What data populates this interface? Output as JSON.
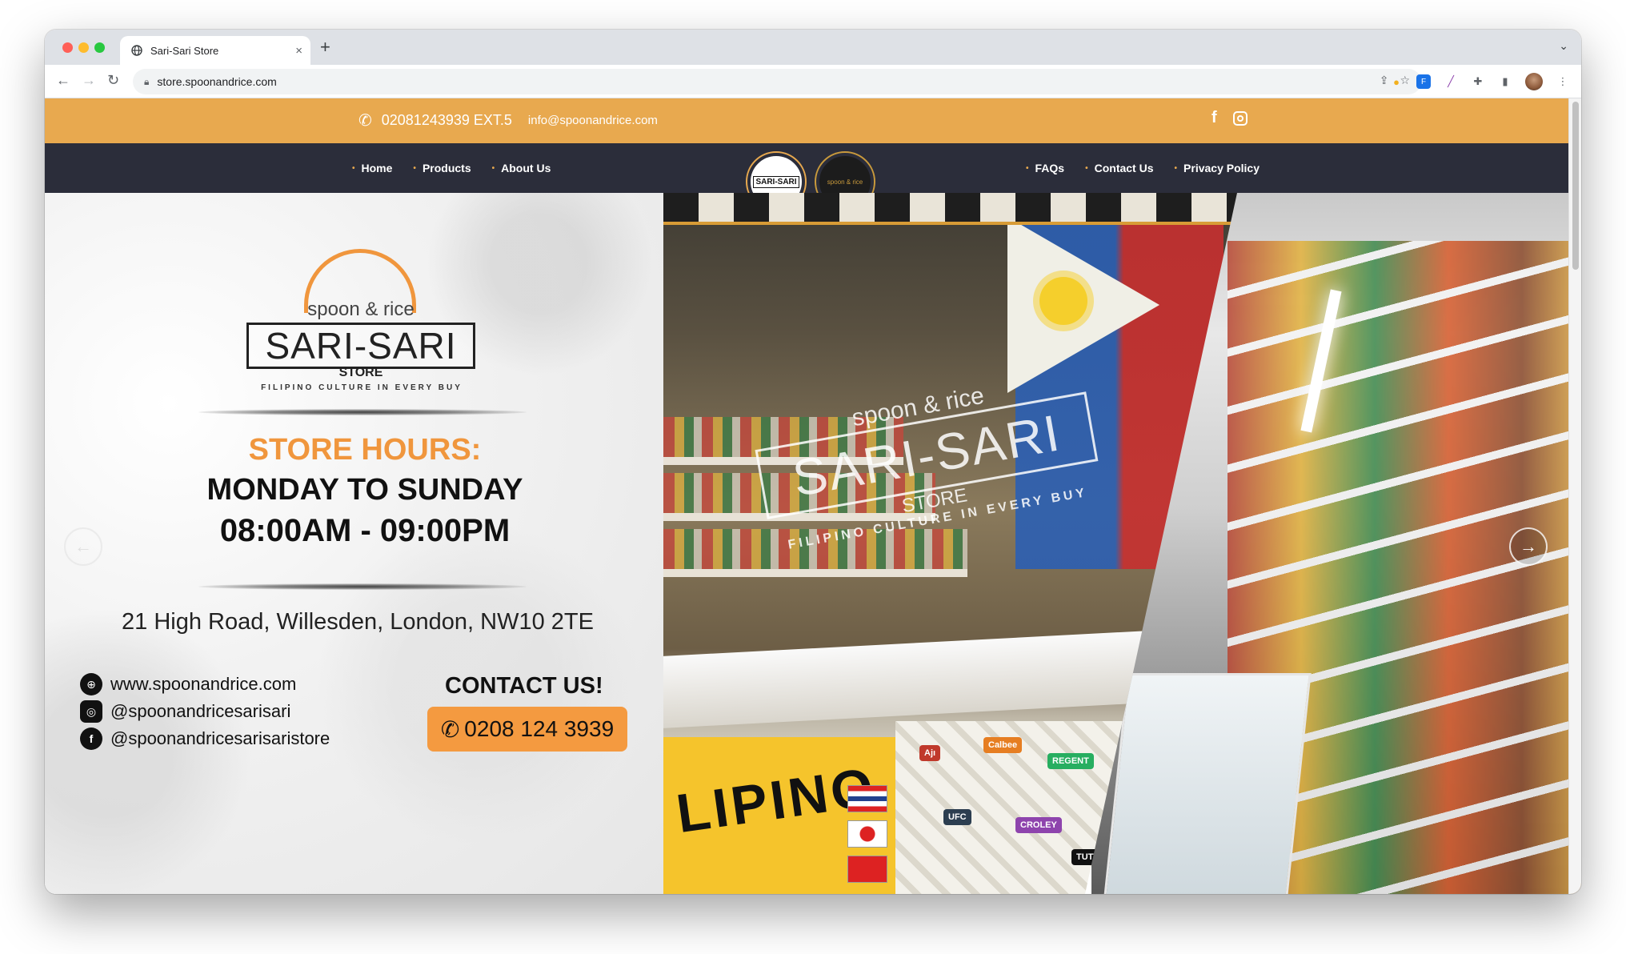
{
  "browser": {
    "tab_title": "Sari-Sari Store",
    "tab_close": "×",
    "new_tab": "+",
    "url": "store.spoonandrice.com"
  },
  "topbar": {
    "phone": "02081243939 EXT.5",
    "email": "info@spoonandrice.com"
  },
  "nav": {
    "left": [
      "Home",
      "Products",
      "About Us"
    ],
    "right": [
      "FAQs",
      "Contact Us",
      "Privacy Policy"
    ],
    "logo1_text": "SARI-SARI",
    "logo2_text": "spoon & rice"
  },
  "hero": {
    "logo": {
      "spoon_rice": "spoon & rice",
      "sari": "SARI-SARI",
      "store": "STORE",
      "tagline": "FILIPINO CULTURE IN EVERY BUY"
    },
    "hours_title": "STORE HOURS:",
    "hours_days": "MONDAY TO SUNDAY",
    "hours_time": "08:00AM - 09:00PM",
    "address": "21 High Road, Willesden, London, NW10 2TE",
    "contacts": [
      {
        "icon": "globe-icon",
        "text": "www.spoonandrice.com"
      },
      {
        "icon": "instagram-icon",
        "text": "@spoonandricesarisari"
      },
      {
        "icon": "facebook-icon",
        "text": "@spoonandricesarisaristore"
      }
    ],
    "contact_us": "CONTACT US!",
    "phone_button": "0208 124 3939",
    "photo_text": {
      "spoon_rice": "spoon & rice",
      "sari": "SARI-SARI",
      "store": "STORE",
      "tagline": "FILIPINO CULTURE IN EVERY BUY",
      "lipino": "LIPINO"
    }
  },
  "colors": {
    "accent_orange": "#e8a94f",
    "nav_dark": "#2b2d3a",
    "button_orange": "#f49a40"
  }
}
